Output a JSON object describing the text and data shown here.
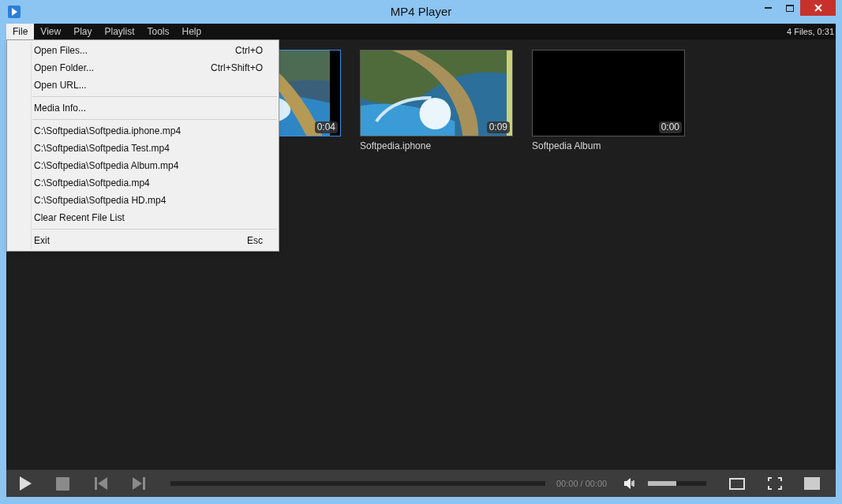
{
  "window": {
    "title": "MP4 Player"
  },
  "menu_bar": {
    "items": [
      {
        "label": "File",
        "selected": true
      },
      {
        "label": "View",
        "selected": false
      },
      {
        "label": "Play",
        "selected": false
      },
      {
        "label": "Playlist",
        "selected": false
      },
      {
        "label": "Tools",
        "selected": false
      },
      {
        "label": "Help",
        "selected": false
      }
    ],
    "summary": "4 Files, 0:31"
  },
  "file_menu": {
    "groups": [
      [
        {
          "label": "Open Files...",
          "shortcut": "Ctrl+O"
        },
        {
          "label": "Open Folder...",
          "shortcut": "Ctrl+Shift+O"
        },
        {
          "label": "Open URL..."
        }
      ],
      [
        {
          "label": "Media Info..."
        }
      ],
      [
        {
          "label": "C:\\Softpedia\\Softpedia.iphone.mp4"
        },
        {
          "label": "C:\\Softpedia\\Softpedia Test.mp4"
        },
        {
          "label": "C:\\Softpedia\\Softpedia Album.mp4"
        },
        {
          "label": "C:\\Softpedia\\Softpedia.mp4"
        },
        {
          "label": "C:\\Softpedia\\Softpedia HD.mp4"
        },
        {
          "label": "Clear Recent File List"
        }
      ],
      [
        {
          "label": "Exit",
          "shortcut": "Esc"
        }
      ]
    ]
  },
  "files": [
    {
      "kind": "picture",
      "duration": "0:04",
      "selected": true
    },
    {
      "kind": "picture",
      "duration": "0:09",
      "name": "Softpedia.iphone",
      "selected": false
    },
    {
      "kind": "blank",
      "duration": "0:00",
      "name": "Softpedia Album",
      "selected": false
    }
  ],
  "controls": {
    "time": "00:00 / 00:00",
    "volume": {
      "level": 0.49
    }
  }
}
